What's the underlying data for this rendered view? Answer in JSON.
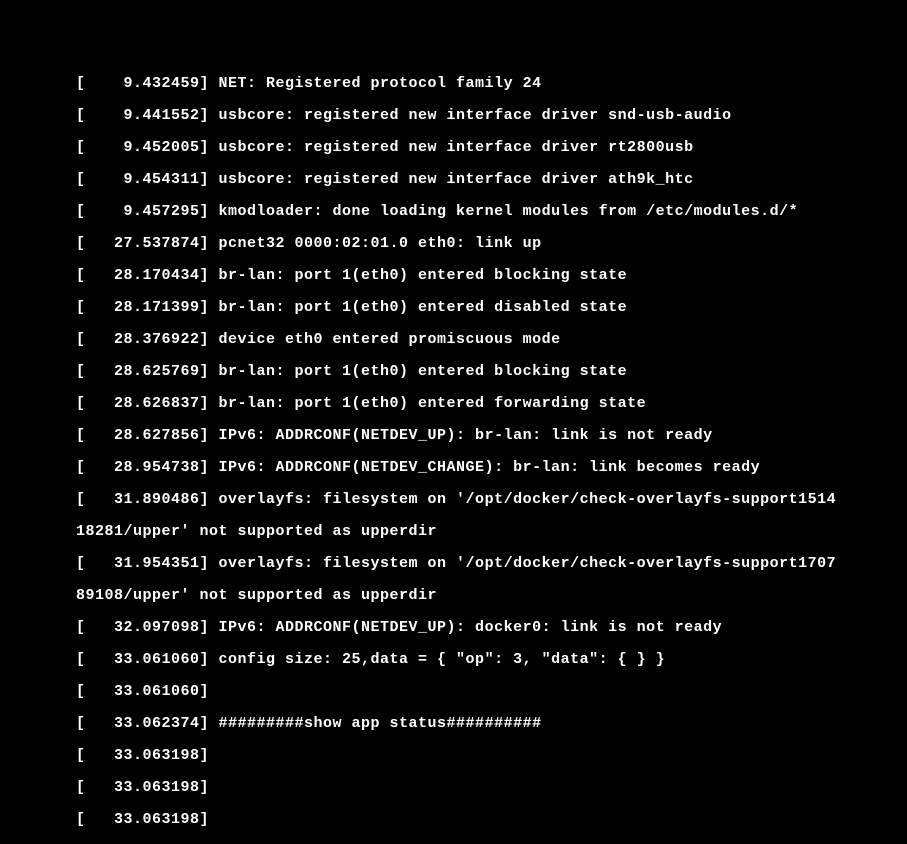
{
  "terminal": {
    "lines": [
      "[    9.432459] NET: Registered protocol family 24",
      "[    9.441552] usbcore: registered new interface driver snd-usb-audio",
      "[    9.452005] usbcore: registered new interface driver rt2800usb",
      "[    9.454311] usbcore: registered new interface driver ath9k_htc",
      "[    9.457295] kmodloader: done loading kernel modules from /etc/modules.d/*",
      "[   27.537874] pcnet32 0000:02:01.0 eth0: link up",
      "[   28.170434] br-lan: port 1(eth0) entered blocking state",
      "[   28.171399] br-lan: port 1(eth0) entered disabled state",
      "[   28.376922] device eth0 entered promiscuous mode",
      "[   28.625769] br-lan: port 1(eth0) entered blocking state",
      "[   28.626837] br-lan: port 1(eth0) entered forwarding state",
      "[   28.627856] IPv6: ADDRCONF(NETDEV_UP): br-lan: link is not ready",
      "[   28.954738] IPv6: ADDRCONF(NETDEV_CHANGE): br-lan: link becomes ready",
      "[   31.890486] overlayfs: filesystem on '/opt/docker/check-overlayfs-support1514",
      "18281/upper' not supported as upperdir",
      "[   31.954351] overlayfs: filesystem on '/opt/docker/check-overlayfs-support1707",
      "89108/upper' not supported as upperdir",
      "[   32.097098] IPv6: ADDRCONF(NETDEV_UP): docker0: link is not ready",
      "[   33.061060] config size: 25,data = { \"op\": 3, \"data\": { } }",
      "[   33.061060]",
      "[   33.062374] #########show app status##########",
      "[   33.063198]",
      "[   33.063198]",
      "[   33.063198]"
    ]
  }
}
